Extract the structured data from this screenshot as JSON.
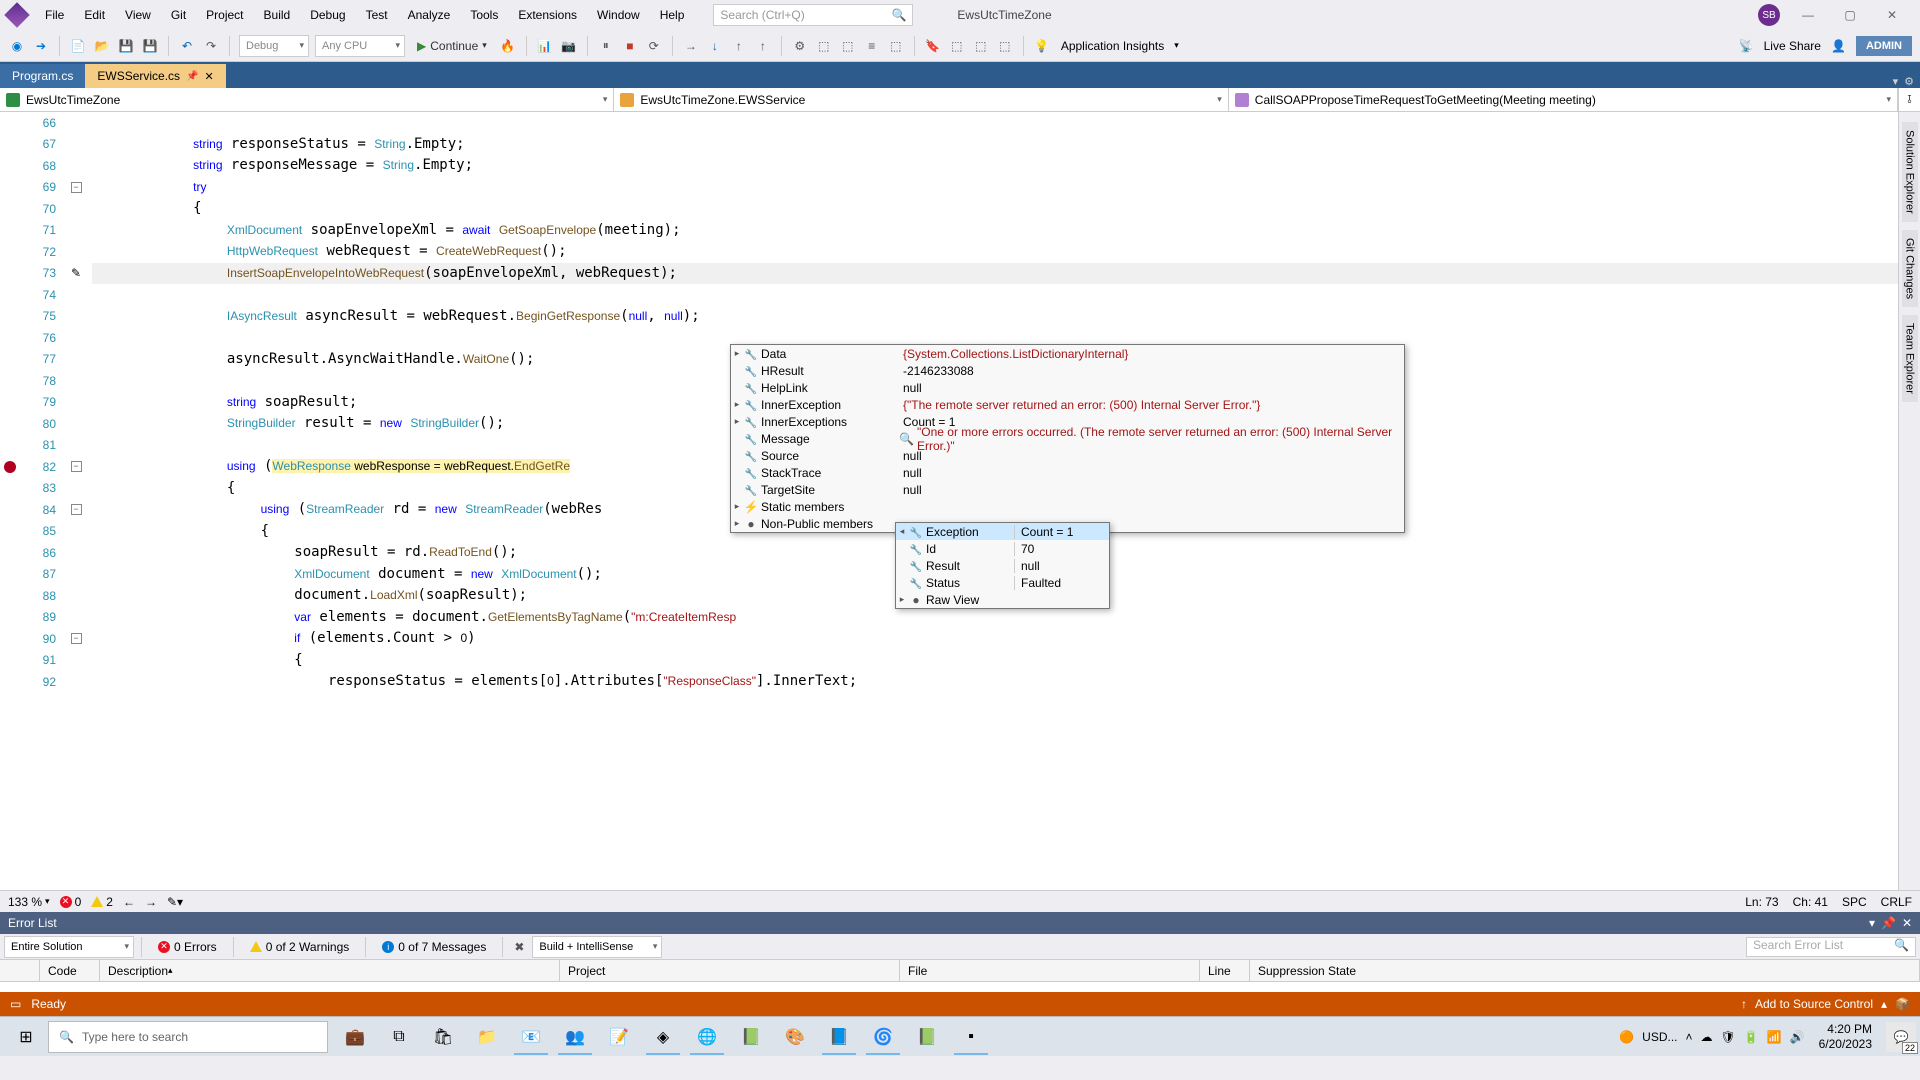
{
  "menu": [
    "File",
    "Edit",
    "View",
    "Git",
    "Project",
    "Build",
    "Debug",
    "Test",
    "Analyze",
    "Tools",
    "Extensions",
    "Window",
    "Help"
  ],
  "searchPlaceholder": "Search (Ctrl+Q)",
  "solutionName": "EwsUtcTimeZone",
  "avatar": "SB",
  "toolbar": {
    "config": "Debug",
    "platform": "Any CPU",
    "continue": "Continue",
    "insights": "Application Insights",
    "liveShare": "Live Share",
    "admin": "ADMIN"
  },
  "tabs": {
    "inactive": "Program.cs",
    "active": "EWSService.cs"
  },
  "nav": {
    "namespace": "EwsUtcTimeZone",
    "class": "EwsUtcTimeZone.EWSService",
    "method": "CallSOAPProposeTimeRequestToGetMeeting(Meeting meeting)"
  },
  "sideTabsRight": [
    "Solution Explorer",
    "Git Changes",
    "Team Explorer"
  ],
  "lines": {
    "start": 66,
    "end": 92
  },
  "dbgBig": [
    {
      "exp": "▸",
      "name": "Data",
      "val": "{System.Collections.ListDictionaryInternal}",
      "cls": ""
    },
    {
      "exp": "",
      "name": "HResult",
      "val": "-2146233088",
      "cls": "num"
    },
    {
      "exp": "",
      "name": "HelpLink",
      "val": "null",
      "cls": "num"
    },
    {
      "exp": "▸",
      "name": "InnerException",
      "val": "{\"The remote server returned an error: (500) Internal Server Error.\"}",
      "cls": ""
    },
    {
      "exp": "▸",
      "name": "InnerExceptions",
      "val": "Count = 1",
      "cls": "num"
    },
    {
      "exp": "",
      "name": "Message",
      "val": "\"One or more errors occurred. (The remote server returned an error: (500) Internal Server Error.)\"",
      "cls": "quoted",
      "mag": true
    },
    {
      "exp": "",
      "name": "Source",
      "val": "null",
      "cls": "num"
    },
    {
      "exp": "",
      "name": "StackTrace",
      "val": "null",
      "cls": "num"
    },
    {
      "exp": "",
      "name": "TargetSite",
      "val": "null",
      "cls": "num"
    },
    {
      "exp": "▸",
      "name": "Static members",
      "val": "",
      "cls": "",
      "ico": "⚡"
    },
    {
      "exp": "▸",
      "name": "Non-Public members",
      "val": "",
      "cls": "",
      "ico": "●"
    }
  ],
  "dbgSmall": [
    {
      "exp": "◂",
      "name": "Exception",
      "val": "Count = 1",
      "sel": true
    },
    {
      "exp": "",
      "name": "Id",
      "val": "70"
    },
    {
      "exp": "",
      "name": "Result",
      "val": "null"
    },
    {
      "exp": "",
      "name": "Status",
      "val": "Faulted"
    },
    {
      "exp": "▸",
      "name": "Raw View",
      "val": "",
      "ico": "●"
    }
  ],
  "editorFoot": {
    "zoom": "133 %",
    "errors": "0",
    "warnings": "2",
    "ln": "Ln: 73",
    "ch": "Ch: 41",
    "spc": "SPC",
    "crlf": "CRLF"
  },
  "errorList": {
    "title": "Error List",
    "scope": "Entire Solution",
    "errors": "0 Errors",
    "warnings": "0 of 2 Warnings",
    "messages": "0 of 7 Messages",
    "build": "Build + IntelliSense",
    "searchPlaceholder": "Search Error List",
    "cols": [
      "",
      "Code",
      "Description",
      "Project",
      "File",
      "Line",
      "Suppression State"
    ]
  },
  "statusbar": {
    "ready": "Ready",
    "addSource": "Add to Source Control"
  },
  "taskbar": {
    "search": "Type here to search",
    "currency": "USD...",
    "time": "4:20 PM",
    "date": "6/20/2023",
    "notif": "22"
  }
}
